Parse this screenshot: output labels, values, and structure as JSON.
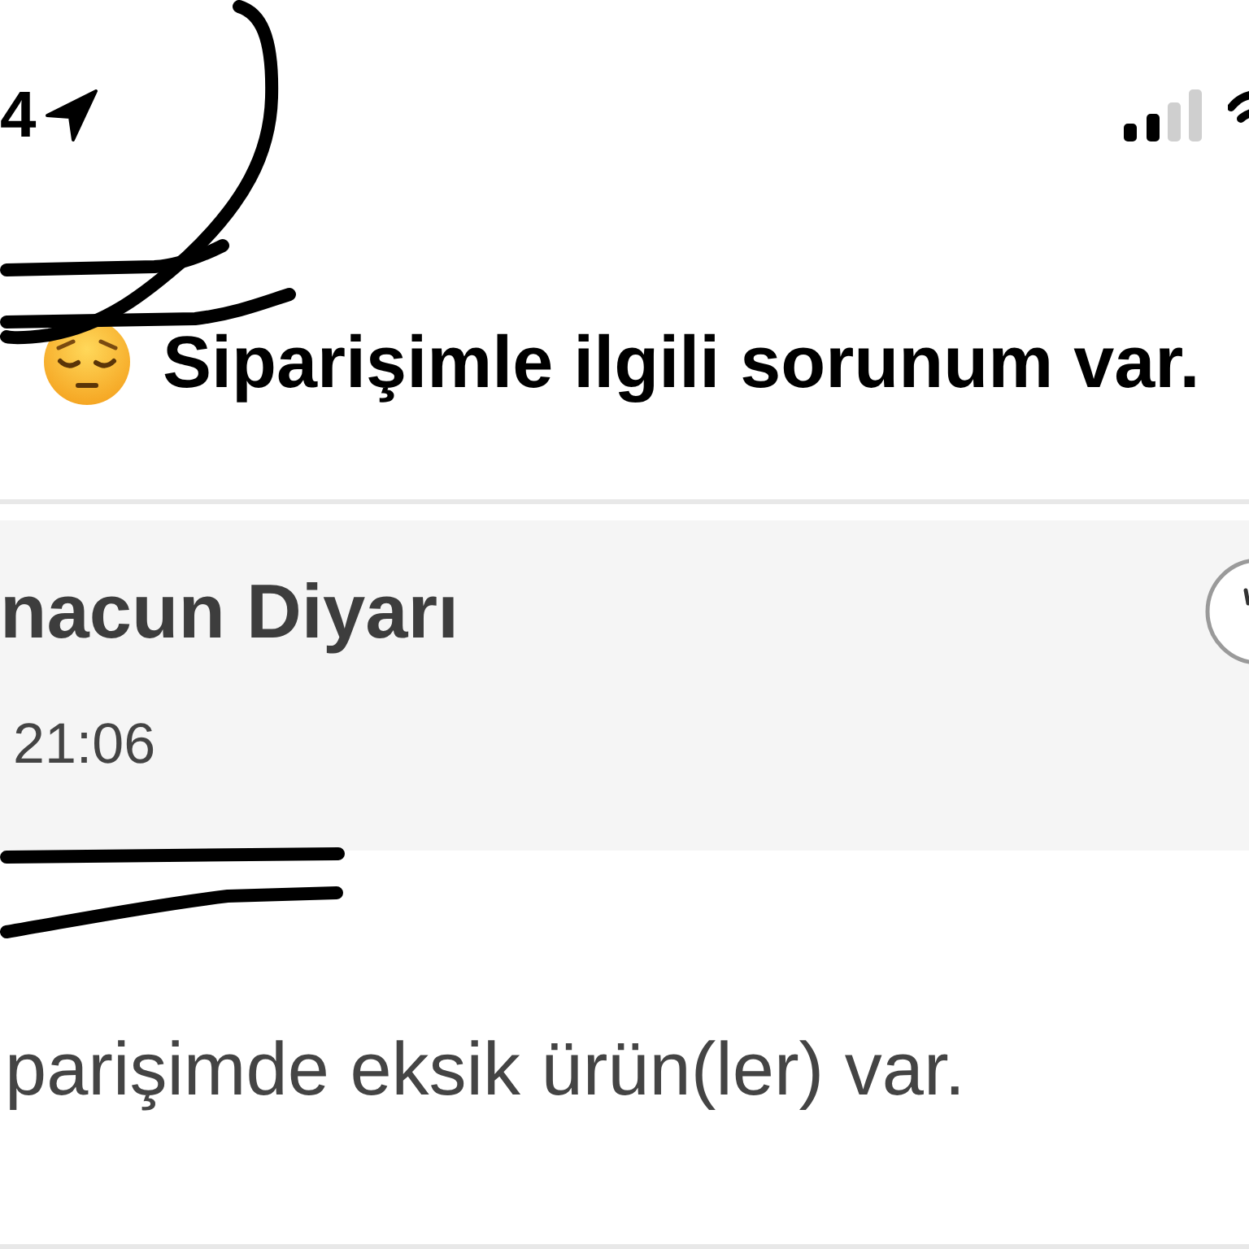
{
  "status_bar": {
    "time": "4"
  },
  "header": {
    "title": "Siparişimle ilgili sorunum var."
  },
  "order": {
    "name": "nacun Diyarı",
    "time": "21:06"
  },
  "issue": {
    "text": "parişimde eksik ürün(ler) var."
  }
}
